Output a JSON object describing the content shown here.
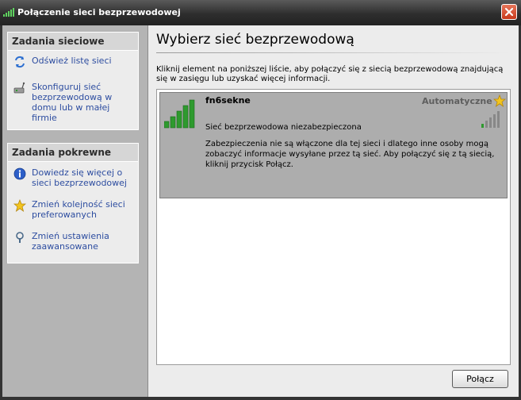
{
  "window": {
    "title": "Połączenie sieci bezprzewodowej"
  },
  "sidebar": {
    "network_tasks": {
      "header": "Zadania sieciowe",
      "items": [
        {
          "label": "Odśwież listę sieci",
          "icon": "refresh-icon"
        },
        {
          "label": "Skonfiguruj sieć bezprzewodową w domu lub w małej firmie",
          "icon": "wireless-setup-icon"
        }
      ]
    },
    "related_tasks": {
      "header": "Zadania pokrewne",
      "items": [
        {
          "label": "Dowiedz się więcej o sieci bezprzewodowej",
          "icon": "info-icon"
        },
        {
          "label": "Zmień kolejność sieci preferowanych",
          "icon": "star-icon"
        },
        {
          "label": "Zmień ustawienia zaawansowane",
          "icon": "settings-icon"
        }
      ]
    }
  },
  "main": {
    "heading": "Wybierz sieć bezprzewodową",
    "instruction": "Kliknij element na poniższej liście, aby połączyć się z siecią bezprzewodową znajdującą się w zasięgu lub uzyskać więcej informacji.",
    "networks": [
      {
        "name": "fn6sekne",
        "mode": "Automatyczne",
        "security": "Sieć bezprzewodowa niezabezpieczona",
        "description": "Zabezpieczenia nie są włączone dla tej sieci i dlatego inne osoby mogą zobaczyć informacje wysyłane przez tą sieć. Aby połączyć się z tą siecią, kliknij przycisk Połącz.",
        "signal_bars": 5
      }
    ],
    "connect_label": "Połącz"
  },
  "colors": {
    "link": "#2d4da0",
    "signal_green": "#2e9a2e",
    "selection": "#adadad",
    "sidebar_bg": "#b4b4b4"
  }
}
